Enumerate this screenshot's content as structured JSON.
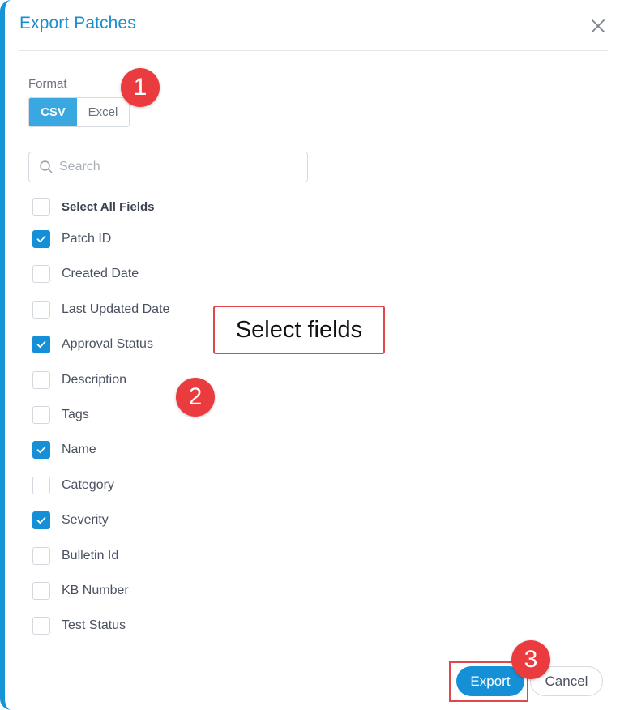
{
  "dialog": {
    "title": "Export Patches",
    "close_icon": "close-icon"
  },
  "format": {
    "label": "Format",
    "options": [
      "CSV",
      "Excel"
    ],
    "selected": "CSV"
  },
  "search": {
    "placeholder": "Search",
    "icon": "search-icon"
  },
  "fields": {
    "select_all_label": "Select All Fields",
    "items": [
      {
        "label": "Patch ID",
        "checked": true
      },
      {
        "label": "Created Date",
        "checked": false
      },
      {
        "label": "Last Updated Date",
        "checked": false
      },
      {
        "label": "Approval Status",
        "checked": true
      },
      {
        "label": "Description",
        "checked": false
      },
      {
        "label": "Tags",
        "checked": false
      },
      {
        "label": "Name",
        "checked": true
      },
      {
        "label": "Category",
        "checked": false
      },
      {
        "label": "Severity",
        "checked": true
      },
      {
        "label": "Bulletin Id",
        "checked": false
      },
      {
        "label": "KB Number",
        "checked": false
      },
      {
        "label": "Test Status",
        "checked": false
      }
    ]
  },
  "annotations": {
    "callout_text": "Select fields",
    "step1": "1",
    "step2": "2",
    "step3": "3"
  },
  "footer": {
    "export_label": "Export",
    "cancel_label": "Cancel"
  },
  "colors": {
    "accent": "#1590d6",
    "title": "#1a8fd0",
    "annotation_red": "#ea3b3f"
  }
}
